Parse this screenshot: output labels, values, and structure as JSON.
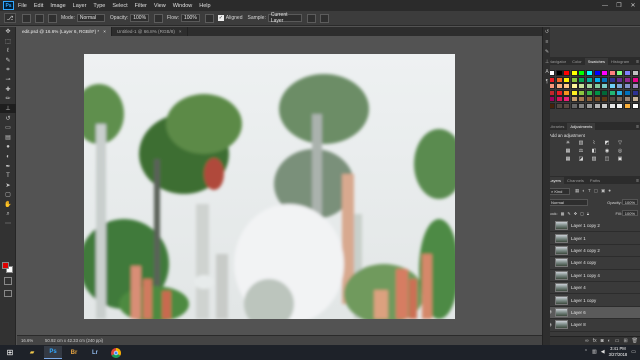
{
  "menubar": {
    "app_logo": "Ps",
    "items": [
      "File",
      "Edit",
      "Image",
      "Layer",
      "Type",
      "Select",
      "Filter",
      "View",
      "Window",
      "Help"
    ],
    "window_controls": [
      "—",
      "❐",
      "✕"
    ]
  },
  "options": {
    "mode_label": "Mode:",
    "mode_value": "Normal",
    "opacity_label": "Opacity:",
    "opacity_value": "100%",
    "flow_label": "Flow:",
    "flow_value": "100%",
    "aligned_label": "Aligned",
    "sample_label": "Sample:",
    "sample_value": "Current Layer"
  },
  "tabs": [
    {
      "label": "edit.psd @ 16.6% (Layer 6, RGB/8*) *",
      "close": "×"
    },
    {
      "label": "Untitled-1 @ 66.8% (RGB/8)",
      "close": "×"
    }
  ],
  "status": {
    "zoom": "16.6%",
    "doc": "50.92 cm x 42.33 cm (240 ppi)"
  },
  "toolbar_icons": [
    "move-icon",
    "marquee-icon",
    "lasso-icon",
    "quick-select-icon",
    "crop-icon",
    "eyedropper-icon",
    "healing-icon",
    "brush-icon",
    "clone-stamp-icon",
    "history-brush-icon",
    "eraser-icon",
    "gradient-icon",
    "blur-icon",
    "dodge-icon",
    "pen-icon",
    "type-icon",
    "path-select-icon",
    "shape-icon",
    "hand-icon",
    "zoom-icon"
  ],
  "fg_color": "#e00000",
  "bg_color": "#ffffff",
  "panels": {
    "swatches_tabs": [
      "Navigator",
      "Color",
      "Swatches",
      "Histogram"
    ],
    "adjust_tabs": [
      "Libraries",
      "Adjustments"
    ],
    "adjust_add_label": "Add an adjustment",
    "layers_tabs": [
      "Layers",
      "Channels",
      "Paths"
    ],
    "kind_label": "Kind",
    "blend_mode": "Normal",
    "opacity_label": "Opacity:",
    "opacity_value": "100%",
    "lock_label": "Lock:",
    "fill_label": "Fill:",
    "fill_value": "100%"
  },
  "layers": [
    {
      "name": "Layer 1 copy 2",
      "visible": false,
      "selected": false
    },
    {
      "name": "Layer 1",
      "visible": false,
      "selected": false
    },
    {
      "name": "Layer 4 copy 2",
      "visible": false,
      "selected": false
    },
    {
      "name": "Layer 4 copy",
      "visible": false,
      "selected": false
    },
    {
      "name": "Layer 1 copy 4",
      "visible": false,
      "selected": false
    },
    {
      "name": "Layer 4",
      "visible": false,
      "selected": false
    },
    {
      "name": "Layer 1 copy",
      "visible": false,
      "selected": false
    },
    {
      "name": "Layer 6",
      "visible": true,
      "selected": true
    },
    {
      "name": "Layer 8",
      "visible": true,
      "selected": false
    }
  ],
  "taskbar": {
    "apps": [
      "Windows Start",
      "File Explorer",
      "Photoshop",
      "Bridge",
      "Lightroom",
      "Chrome"
    ],
    "time": "3:41 PM",
    "date": "3/27/2018"
  }
}
